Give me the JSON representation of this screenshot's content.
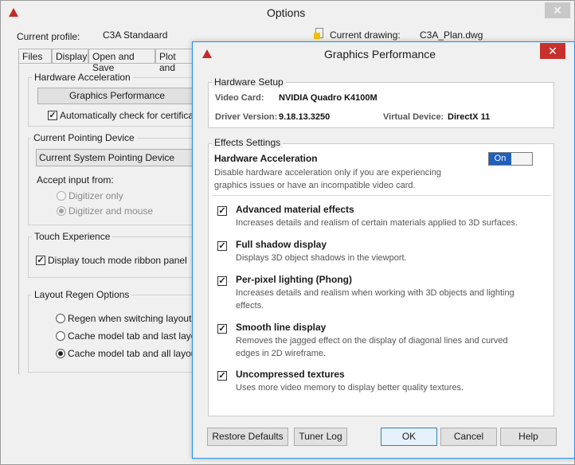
{
  "options_window": {
    "title": "Options",
    "current_profile_label": "Current profile:",
    "current_profile_value": "C3A Standaard",
    "current_drawing_label": "Current drawing:",
    "current_drawing_value": "C3A_Plan.dwg",
    "close_label": "✕",
    "tabs": [
      "Files",
      "Display",
      "Open and Save",
      "Plot and"
    ],
    "hardware_acceleration": {
      "title": "Hardware Acceleration",
      "button": "Graphics Performance",
      "auto_check": "Automatically check for certification"
    },
    "pointing_device": {
      "title": "Current Pointing Device",
      "select_value": "Current System Pointing Device",
      "accept_label": "Accept input from:",
      "digitizer_only": "Digitizer only",
      "digitizer_and_mouse": "Digitizer and mouse"
    },
    "touch": {
      "title": "Touch Experience",
      "ribbon": "Display touch mode ribbon panel"
    },
    "layout_regen": {
      "title": "Layout Regen Options",
      "opt1": "Regen when switching layouts",
      "opt2": "Cache model tab and last layout",
      "opt3": "Cache model tab and all layouts"
    }
  },
  "graphics_performance": {
    "title": "Graphics Performance",
    "close_label": "✕",
    "hardware_setup": {
      "title": "Hardware Setup",
      "video_card_label": "Video Card:",
      "video_card_value": "NVIDIA Quadro K4100M",
      "driver_version_label": "Driver Version:",
      "driver_version_value": "9.18.13.3250",
      "virtual_device_label": "Virtual Device:",
      "virtual_device_value": "DirectX 11"
    },
    "effects": {
      "title": "Effects Settings",
      "hw_accel_title": "Hardware Acceleration",
      "hw_accel_desc_1": "Disable hardware acceleration only if you are experiencing",
      "hw_accel_desc_2": "graphics issues or have an incompatible video card.",
      "toggle_label": "On",
      "options": [
        {
          "title": "Advanced material effects",
          "desc": [
            "Increases details and realism of certain materials applied to 3D surfaces."
          ]
        },
        {
          "title": "Full shadow display",
          "desc": [
            "Displays 3D object shadows in the viewport."
          ]
        },
        {
          "title": "Per-pixel lighting (Phong)",
          "desc": [
            "Increases details and realism when working with 3D objects and lighting",
            "effects."
          ]
        },
        {
          "title": "Smooth line display",
          "desc": [
            "Removes the jagged effect on the display of diagonal lines and curved",
            "edges in 2D wireframe."
          ]
        },
        {
          "title": "Uncompressed textures",
          "desc": [
            "Uses more video memory to display better quality textures."
          ]
        }
      ]
    },
    "buttons": {
      "restore": "Restore Defaults",
      "tuner": "Tuner Log",
      "ok": "OK",
      "cancel": "Cancel",
      "help": "Help"
    }
  }
}
